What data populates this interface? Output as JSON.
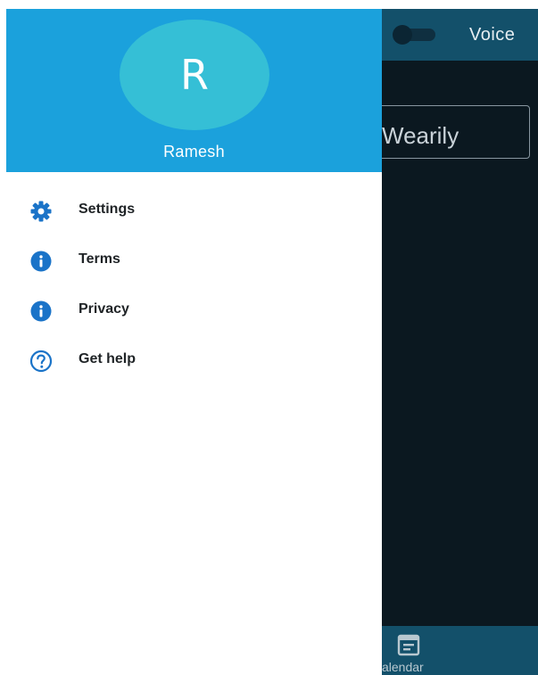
{
  "app": {
    "toggle_label": "Voice",
    "word": "Wearily",
    "bottom_tab_label": "alendar",
    "bottom_tab_icon": "calendar-icon"
  },
  "drawer": {
    "avatar_initial": "R",
    "user_name": "Ramesh",
    "items": [
      {
        "label": "Settings",
        "icon": "gear-icon"
      },
      {
        "label": "Terms",
        "icon": "info-icon"
      },
      {
        "label": "Privacy",
        "icon": "info-icon"
      },
      {
        "label": "Get help",
        "icon": "help-icon"
      }
    ]
  },
  "colors": {
    "drawer_header": "#1ba1dc",
    "avatar": "#35bfd6",
    "icon_accent": "#1a73c8",
    "app_background": "#0b1820",
    "app_bar": "#13506a"
  }
}
